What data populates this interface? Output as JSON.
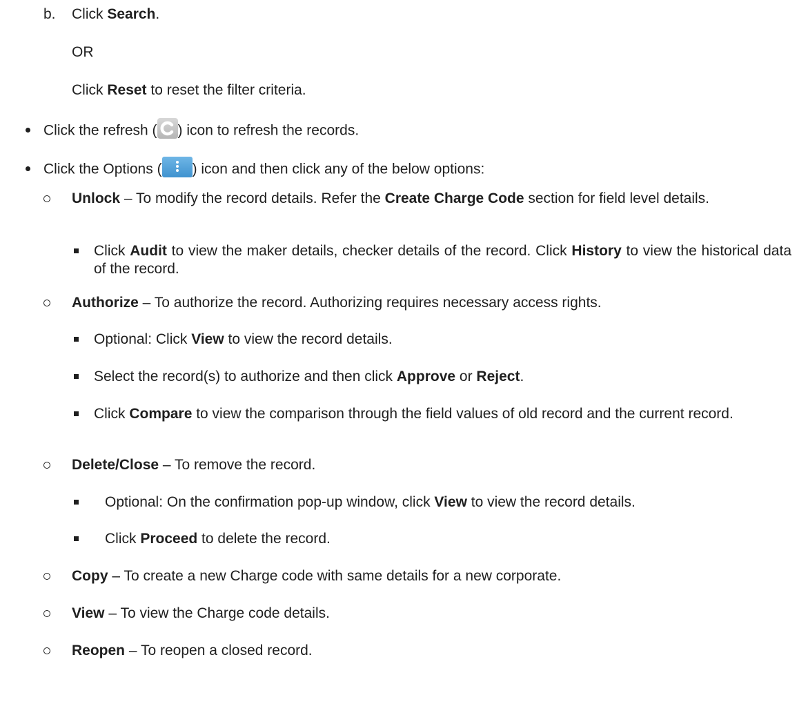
{
  "step_b": {
    "marker": "b.",
    "t1": "Click ",
    "b1": "Search",
    "t2": "."
  },
  "or_text": "OR",
  "reset_line": {
    "t1": "Click ",
    "b1": "Reset",
    "t2": " to reset the filter criteria."
  },
  "refresh_bullet": {
    "t1": "Click the refresh (",
    "icon": "refresh-icon",
    "t2": ") icon to refresh the records."
  },
  "options_bullet": {
    "t1": "Click the Options (",
    "icon": "vertical-ellipsis-icon",
    "t2": ") icon and then click any of the below options:"
  },
  "options": [
    {
      "b": "Unlock",
      "t": " – To modify the record details. Refer the ",
      "b2": "Create Charge Code",
      "t2": " section for field level details.",
      "subitems": [
        {
          "t1": "Click ",
          "b1": "Audit",
          "t2": " to view the maker details, checker details of the record. Click ",
          "b2": "History",
          "t3": " to view the historical data of the record."
        }
      ]
    },
    {
      "b": "Authorize",
      "t": " – To authorize the record. Authorizing requires necessary access rights.",
      "subitems": [
        {
          "t1": "Optional: Click ",
          "b1": "View",
          "t2": " to view the record details."
        },
        {
          "t1": "Select the record(s) to authorize and then click ",
          "b1": "Approve",
          "t2": " or ",
          "b2": "Reject",
          "t3": "."
        },
        {
          "t1": "Click ",
          "b1": "Compare",
          "t2": " to view the comparison through the field values of old record and the current record."
        }
      ]
    },
    {
      "b": "Delete/Close",
      "t": " – To remove the record.",
      "subitems": [
        {
          "t1": "Optional: On the confirmation pop-up window, click ",
          "b1": "View",
          "t2": " to view the record details."
        },
        {
          "t1": "Click ",
          "b1": "Proceed",
          "t2": " to delete the record."
        }
      ]
    },
    {
      "b": "Copy",
      "t": " – To create a new Charge code with same details for a new corporate."
    },
    {
      "b": "View",
      "t": " – To view the Charge code details."
    },
    {
      "b": "Reopen",
      "t": " – To reopen a closed record."
    }
  ],
  "colors": {
    "text": "#1f1f1f",
    "refresh_icon_bg": "#c4c4c4",
    "options_icon_bg": "#4a9bd6"
  }
}
